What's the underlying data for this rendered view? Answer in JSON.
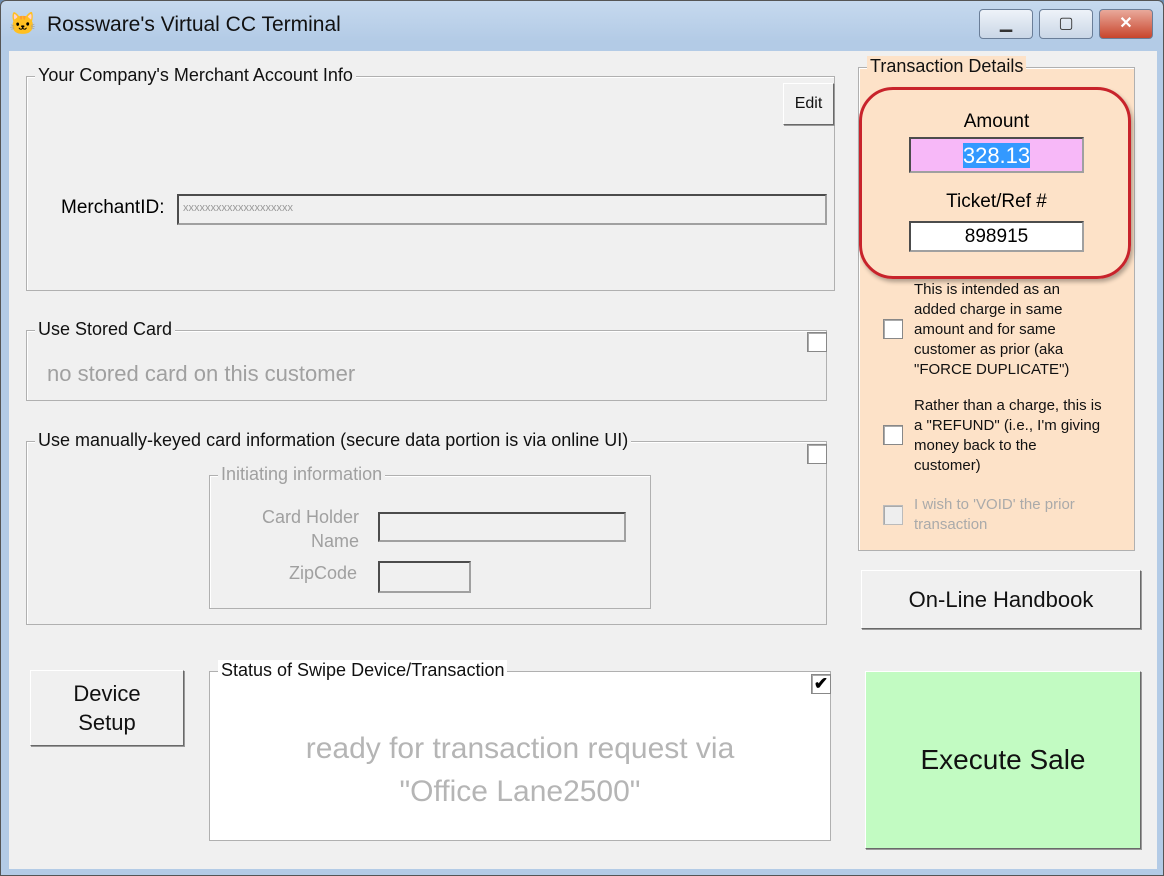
{
  "window": {
    "title": "Rossware's Virtual CC Terminal",
    "minimize": "▁",
    "maximize": "▢",
    "close": "✕"
  },
  "merchant": {
    "legend": "Your Company's Merchant Account Info",
    "edit": "Edit",
    "id_label": "MerchantID:",
    "id_value": "xxxxxxxxxxxxxxxxxxxx"
  },
  "stored": {
    "legend": "Use Stored Card",
    "message": "no stored card on this customer"
  },
  "manual": {
    "legend": "Use manually-keyed card information (secure data portion is via online UI)",
    "init_legend": "Initiating information",
    "holder_label_1": "Card Holder",
    "holder_label_2": "Name",
    "zip_label": "ZipCode"
  },
  "device_setup": {
    "line1": "Device",
    "line2": "Setup"
  },
  "status": {
    "legend": "Status of Swipe Device/Transaction",
    "line1": "ready for transaction request via",
    "line2": "\"Office Lane2500\"",
    "checked": true
  },
  "transaction": {
    "legend": "Transaction Details",
    "amount_label": "Amount",
    "amount": "328.13",
    "ticket_label": "Ticket/Ref #",
    "ticket": "898915",
    "options": [
      {
        "label": "This is intended as an added charge in same amount and for same customer as prior (aka \"FORCE DUPLICATE\")",
        "checked": false,
        "enabled": true
      },
      {
        "label": "Rather than a charge, this is a \"REFUND\" (i.e., I'm giving money back to the customer)",
        "checked": false,
        "enabled": true
      },
      {
        "label": "I wish to 'VOID' the prior transaction",
        "checked": false,
        "enabled": false
      }
    ]
  },
  "handbook": "On-Line Handbook",
  "execute": "Execute Sale",
  "colors": {
    "panel": "#fde2c8",
    "amount_bg": "#f7b8f8",
    "execute_bg": "#c2fbc2",
    "highlight": "#c8232b"
  }
}
